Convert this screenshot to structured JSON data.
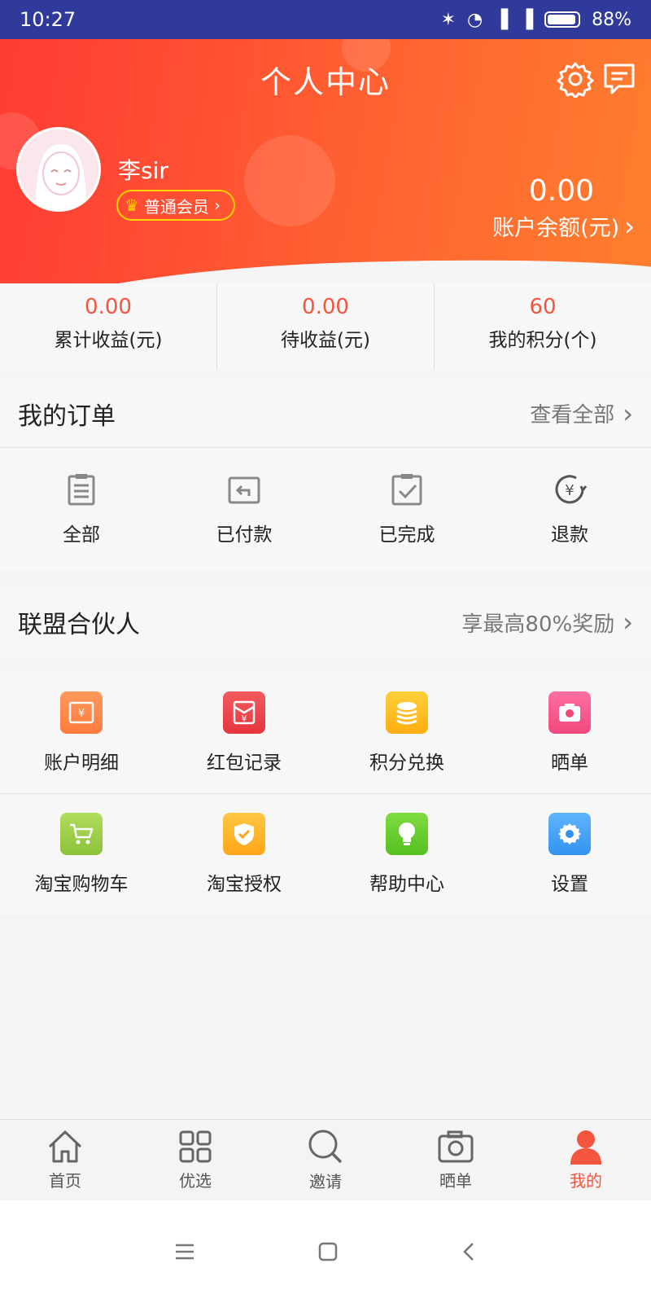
{
  "status_bar": {
    "time": "10:27",
    "battery": "88%"
  },
  "header": {
    "title": "个人中心",
    "user_name": "李sir",
    "member_level": "普通会员",
    "balance_value": "0.00",
    "balance_label": "账户余额(元)"
  },
  "stats": [
    {
      "value": "0.00",
      "label": "累计收益(元)"
    },
    {
      "value": "0.00",
      "label": "待收益(元)"
    },
    {
      "value": "60",
      "label": "我的积分(个)"
    }
  ],
  "orders": {
    "title": "我的订单",
    "view_all": "查看全部",
    "items": [
      {
        "label": "全部",
        "icon": "clipboard-list-icon"
      },
      {
        "label": "已付款",
        "icon": "paid-return-icon"
      },
      {
        "label": "已完成",
        "icon": "clipboard-check-icon"
      },
      {
        "label": "退款",
        "icon": "yen-refund-icon"
      }
    ]
  },
  "partner": {
    "title": "联盟合伙人",
    "promo": "享最高80%奖励"
  },
  "services": [
    {
      "label": "账户明细",
      "icon": "account-detail-icon",
      "color": "#ff8a4c"
    },
    {
      "label": "红包记录",
      "icon": "red-envelope-icon",
      "color": "#f0454f"
    },
    {
      "label": "积分兑换",
      "icon": "coins-icon",
      "color": "#ffbf1f"
    },
    {
      "label": "晒单",
      "icon": "camera-icon",
      "color": "#f7588c"
    },
    {
      "label": "淘宝购物车",
      "icon": "cart-icon",
      "color": "#9bcf3c"
    },
    {
      "label": "淘宝授权",
      "icon": "shield-check-icon",
      "color": "#ffb82b"
    },
    {
      "label": "帮助中心",
      "icon": "lightbulb-icon",
      "color": "#66cf2c"
    },
    {
      "label": "设置",
      "icon": "gear-icon",
      "color": "#3d9ef5"
    }
  ],
  "tabbar": [
    {
      "label": "首页",
      "icon": "home-icon"
    },
    {
      "label": "优选",
      "icon": "grid-icon"
    },
    {
      "label": "邀请",
      "icon": "search-icon"
    },
    {
      "label": "晒单",
      "icon": "camera-icon"
    },
    {
      "label": "我的",
      "icon": "person-icon",
      "active": true
    }
  ],
  "colors": {
    "accent": "#f4553f",
    "header_start": "#ff3b34",
    "header_end": "#ff7f2e",
    "status_bar": "#2f3a9a"
  }
}
